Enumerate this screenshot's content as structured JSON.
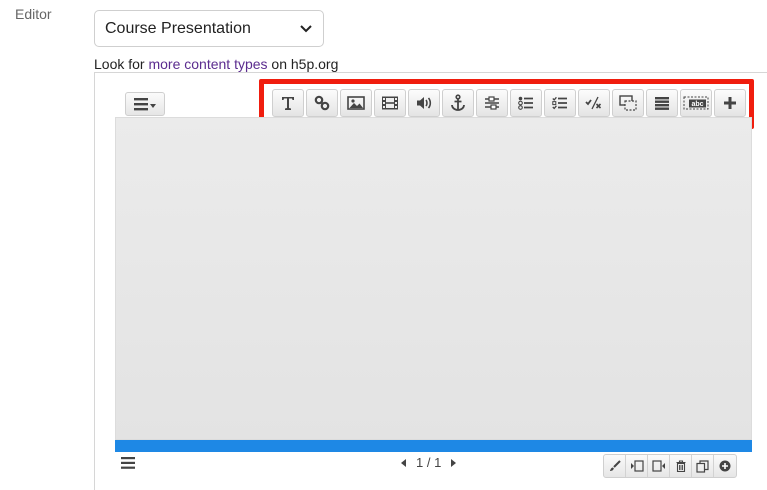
{
  "form": {
    "label": "Editor",
    "content_type": {
      "selected": "Course Presentation",
      "icon": "chevron-down-icon"
    },
    "lookfor": {
      "prefix": "Look for ",
      "link": "more content types",
      "suffix": " on h5p.org"
    }
  },
  "toolbar": {
    "menu_icon": "menu-dropdown-icon",
    "tools": [
      {
        "name": "text",
        "icon": "text-icon"
      },
      {
        "name": "link",
        "icon": "link-icon"
      },
      {
        "name": "image",
        "icon": "image-icon"
      },
      {
        "name": "video",
        "icon": "video-icon"
      },
      {
        "name": "audio",
        "icon": "audio-icon"
      },
      {
        "name": "anchor",
        "icon": "anchor-icon"
      },
      {
        "name": "fill-blanks",
        "icon": "fill-blanks-icon"
      },
      {
        "name": "single-choice",
        "icon": "single-choice-icon"
      },
      {
        "name": "multi-choice",
        "icon": "multi-choice-icon"
      },
      {
        "name": "true-false",
        "icon": "true-false-icon"
      },
      {
        "name": "drag-drop",
        "icon": "drag-drop-icon"
      },
      {
        "name": "summary",
        "icon": "summary-icon"
      },
      {
        "name": "drag-text",
        "icon": "drag-text-icon"
      },
      {
        "name": "more",
        "icon": "plus-icon"
      }
    ],
    "highlight_color": "#f01d0e"
  },
  "slide": {
    "progress_color": "#1e88e5",
    "pager": {
      "current": "1",
      "separator": "/",
      "total": "1"
    }
  },
  "slide_tools": [
    {
      "name": "background",
      "icon": "brush-icon"
    },
    {
      "name": "move-left",
      "icon": "move-left-icon"
    },
    {
      "name": "move-right",
      "icon": "move-right-icon"
    },
    {
      "name": "delete",
      "icon": "trash-icon"
    },
    {
      "name": "clone",
      "icon": "clone-icon"
    },
    {
      "name": "add",
      "icon": "add-circle-icon"
    }
  ]
}
